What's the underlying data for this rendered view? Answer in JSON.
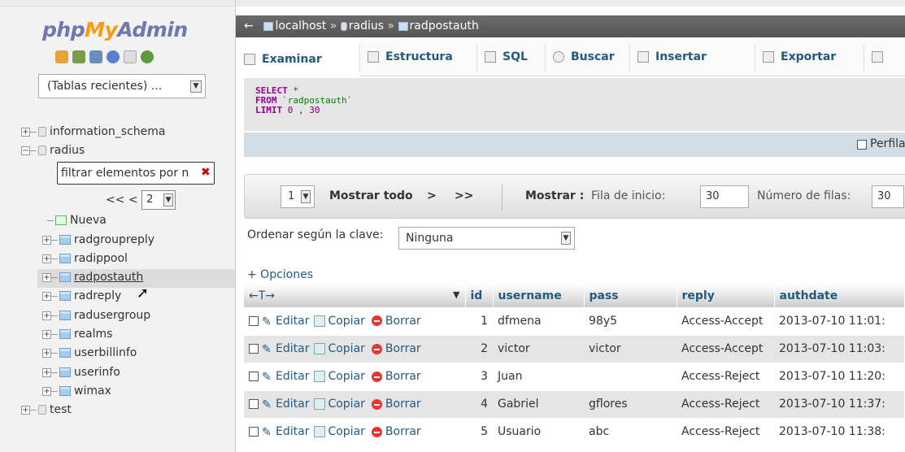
{
  "sidebar": {
    "logo": {
      "php": "php",
      "my": "My",
      "admin": "Admin"
    },
    "nav_icons": [
      "home-icon",
      "database-icon",
      "query-icon",
      "help-icon",
      "docs-icon",
      "reload-icon"
    ],
    "recent_tables": "(Tablas recientes) ...",
    "databases": [
      {
        "name": "information_schema",
        "expanded": false
      },
      {
        "name": "radius",
        "expanded": true
      },
      {
        "name": "test",
        "expanded": false
      }
    ],
    "filter_placeholder": "filtrar elementos por n",
    "pager": {
      "prev": "<< <",
      "page": "2"
    },
    "new_table": "Nueva",
    "tables": [
      "radgroupreply",
      "radippool",
      "radpostauth",
      "radreply",
      "radusergroup",
      "realms",
      "userbillinfo",
      "userinfo",
      "wimax"
    ],
    "selected_table": "radpostauth"
  },
  "breadcrumb": {
    "back": "←",
    "server": "localhost",
    "db": "radius",
    "table": "radpostauth",
    "sep": "»"
  },
  "tabs": [
    "Examinar",
    "Estructura",
    "SQL",
    "Buscar",
    "Insertar",
    "Exportar"
  ],
  "sql": {
    "select": "SELECT",
    "star": "*",
    "from": "FROM",
    "table": "`radpostauth`",
    "limit": "LIMIT",
    "offset": "0",
    "comma": ",",
    "count": "30"
  },
  "profile_label": "Perfilando",
  "navigation": {
    "page": "1",
    "show_all": "Mostrar todo",
    "next": ">",
    "last": ">>",
    "show_label": "Mostrar :",
    "start_label": "Fila de inicio:",
    "start_value": "30",
    "rows_label": "Número de filas:",
    "rows_value": "30"
  },
  "sort": {
    "label": "Ordenar según la clave:",
    "value": "Ninguna"
  },
  "options_link": "+ Opciones",
  "table": {
    "arrows": "←T→",
    "columns": [
      "id",
      "username",
      "pass",
      "reply",
      "authdate"
    ],
    "action_labels": {
      "edit": "Editar",
      "copy": "Copiar",
      "delete": "Borrar"
    },
    "rows": [
      [
        "1",
        "dfmena",
        "98y5",
        "Access-Accept",
        "2013-07-10 11:01:"
      ],
      [
        "2",
        "victor",
        "victor",
        "Access-Accept",
        "2013-07-10 11:03:"
      ],
      [
        "3",
        "Juan",
        "",
        "Access-Reject",
        "2013-07-10 11:20:"
      ],
      [
        "4",
        "Gabriel",
        "gflores",
        "Access-Reject",
        "2013-07-10 11:37:"
      ],
      [
        "5",
        "Usuario",
        "abc",
        "Access-Reject",
        "2013-07-10 11:38:"
      ]
    ]
  }
}
